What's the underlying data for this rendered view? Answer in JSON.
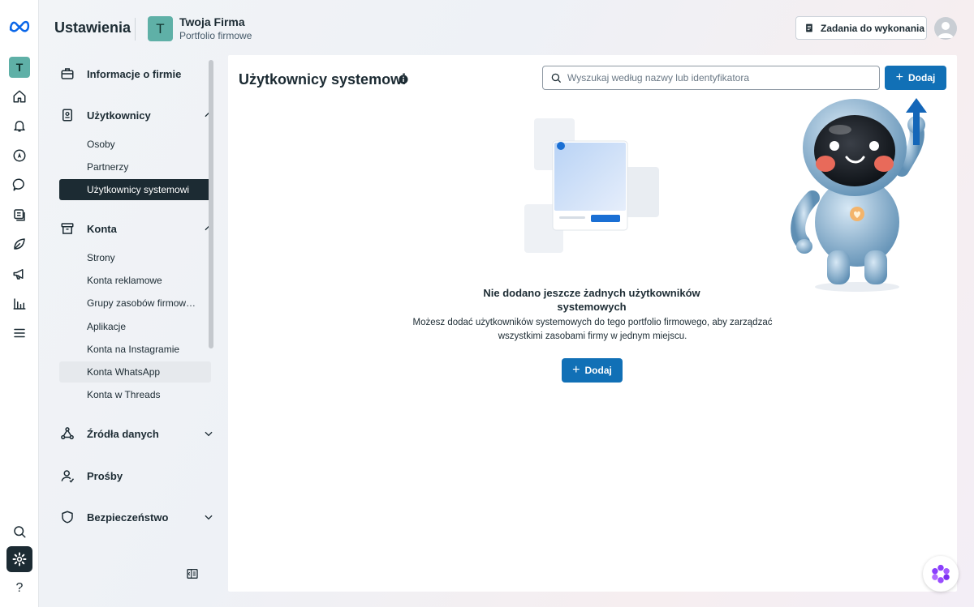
{
  "header": {
    "title": "Ustawienia",
    "business_initial": "T",
    "business_name": "Twoja Firma",
    "business_subtitle": "Portfolio firmowe",
    "tasks_button": "Zadania do wykonania"
  },
  "rail": {
    "account_initial": "T",
    "help_glyph": "?"
  },
  "sidebar": {
    "company_info": "Informacje o firmie",
    "users_section": {
      "label": "Użytkownicy",
      "items": [
        "Osoby",
        "Partnerzy",
        "Użytkownicy systemowi"
      ]
    },
    "accounts_section": {
      "label": "Konta",
      "items": [
        "Strony",
        "Konta reklamowe",
        "Grupy zasobów firmowych",
        "Aplikacje",
        "Konta na Instagramie",
        "Konta WhatsApp",
        "Konta w Threads"
      ]
    },
    "data_sources": "Źródła danych",
    "requests": "Prośby",
    "security": "Bezpieczeństwo"
  },
  "main": {
    "title": "Użytkownicy systemowi",
    "search_placeholder": "Wyszukaj według nazwy lub identyfikatora",
    "add_button": "Dodaj",
    "empty_title": "Nie dodano jeszcze żadnych użytkowników systemowych",
    "empty_description": "Możesz dodać użytkowników systemowych do tego portfolio firmowego, aby zarządzać wszystkimi zasobami firmy w jednym miejscu.",
    "empty_add_button": "Dodaj"
  },
  "colors": {
    "accent": "#1170b6",
    "selected_bg": "#1c2b33",
    "avatar_teal": "#5fb0a7"
  },
  "icons": [
    "meta-logo-icon",
    "home-icon",
    "bell-icon",
    "compass-icon",
    "chat-icon",
    "pages-icon",
    "leaf-icon",
    "megaphone-icon",
    "chart-icon",
    "menu-icon",
    "search-icon",
    "gear-icon",
    "help-icon",
    "briefcase-icon",
    "badge-icon",
    "archive-icon",
    "nodes-icon",
    "person-icon",
    "shield-icon",
    "info-icon",
    "plus-icon",
    "checklist-icon",
    "sidebar-collapse-icon",
    "assistant-icon"
  ]
}
